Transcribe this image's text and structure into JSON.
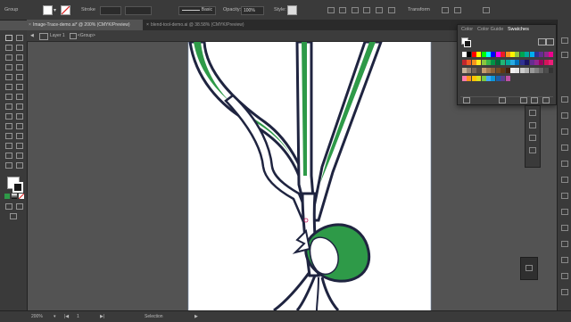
{
  "control_bar": {
    "selection": "Group",
    "stroke_label": "Stroke",
    "style_preset": "Basic",
    "opacity_label": "Opacity:",
    "opacity_value": "100%",
    "style_label": "Style:",
    "transform_label": "Transform"
  },
  "tabs": [
    {
      "label": "Image-Trace-demo.ai* @ 200% (CMYK/Preview)",
      "active": true
    },
    {
      "label": "blend-tool-demo.ai @ 38.58% (CMYK/Preview)",
      "active": false
    }
  ],
  "breadcrumb": {
    "layer": "Layer 1",
    "group": "<Group>"
  },
  "swatches_panel": {
    "tabs": [
      "Color",
      "Color Guide",
      "Swatches"
    ],
    "active_tab": "Swatches"
  },
  "status": {
    "zoom": "200%",
    "artboard": "1",
    "tool": "Selection"
  },
  "colors": {
    "leaf_green": "#2e9a48",
    "ink": "#1f2440",
    "highlight": "#ffffff"
  }
}
